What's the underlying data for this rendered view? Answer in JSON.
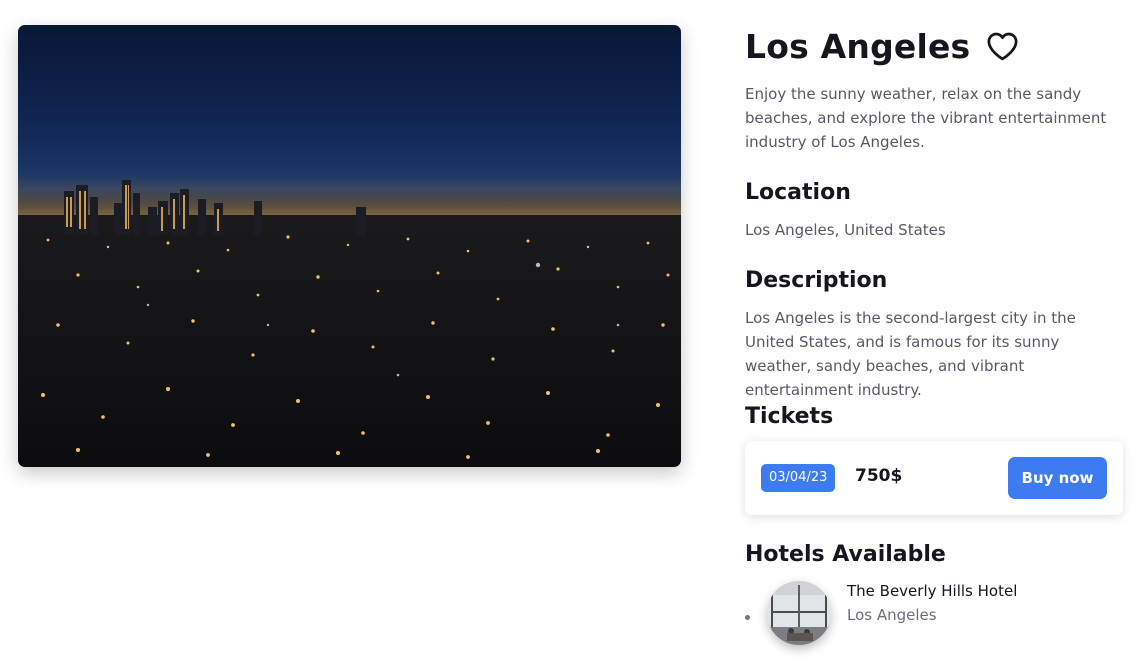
{
  "destination": {
    "title": "Los Angeles",
    "intro": "Enjoy the sunny weather, relax on the sandy beaches, and explore the vibrant entertainment industry of Los Angeles.",
    "hero_image": "Los Angeles city skyline at night"
  },
  "location": {
    "heading": "Location",
    "value": "Los Angeles, United States"
  },
  "description": {
    "heading": "Description",
    "text": "Los Angeles is the second-largest city in the United States, and is famous for its sunny weather, sandy beaches, and vibrant entertainment industry."
  },
  "tickets": {
    "heading": "Tickets",
    "items": [
      {
        "date": "03/04/23",
        "price": "750$",
        "button": "Buy now"
      }
    ]
  },
  "hotels": {
    "heading": "Hotels Available",
    "items": [
      {
        "name": "The Beverly Hills Hotel",
        "city": "Los Angeles"
      }
    ]
  },
  "icons": {
    "favorite": "heart-outline-icon"
  },
  "colors": {
    "accent": "#3d7bf0",
    "heading": "#16161f",
    "body_text": "#555a66"
  }
}
